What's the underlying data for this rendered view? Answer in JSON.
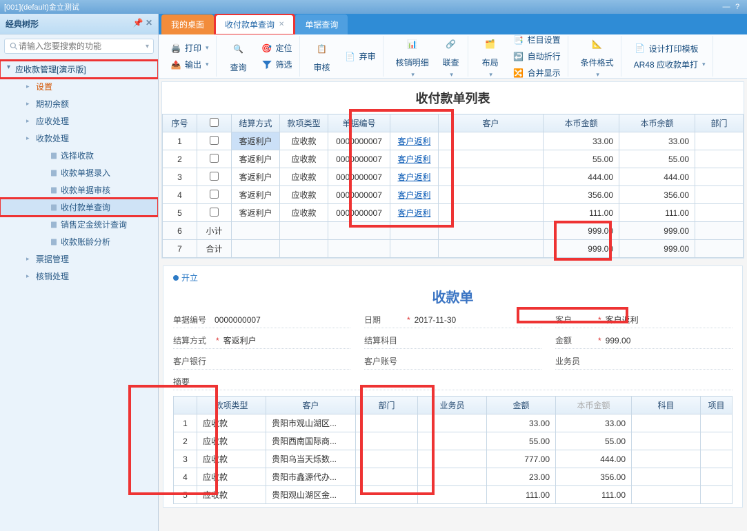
{
  "titlebar": {
    "text": "[001](default)金立测试"
  },
  "sidebar": {
    "title": "经典树形",
    "search_placeholder": "请输入您要搜索的功能",
    "root": "应收款管理[演示版]",
    "n_setup": "设置",
    "n_opening": "期初余额",
    "n_arproc": "应收处理",
    "n_rcvproc": "收款处理",
    "leaf_select": "选择收款",
    "leaf_entry": "收款单据录入",
    "leaf_audit": "收款单据审核",
    "leaf_query": "收付款单查询",
    "leaf_deposit": "销售定金统计查询",
    "leaf_aging": "收款账龄分析",
    "n_bill": "票据管理",
    "n_writeoff": "核销处理"
  },
  "tabs": {
    "desktop": "我的桌面",
    "query": "收付款单查询",
    "billquery": "单据查询"
  },
  "toolbar": {
    "print": "打印",
    "export": "输出",
    "query": "查询",
    "locate": "定位",
    "filter": "筛选",
    "audit": "审核",
    "abandon": "弃审",
    "detail": "核销明细",
    "link": "联查",
    "layout": "布局",
    "colset": "栏目设置",
    "autowrap": "自动折行",
    "mergeshow": "合并显示",
    "condfmt": "条件格式",
    "designtpl": "设计打印模板",
    "ar48": "AR48 应收款单打"
  },
  "list": {
    "title": "收付款单列表",
    "cols": {
      "seq": "序号",
      "check": "",
      "settle": "结算方式",
      "type": "款项类型",
      "billno": "单据编号",
      "blank": "",
      "cust": "客户",
      "bbamt": "本币金额",
      "bbbal": "本币余额",
      "dept": "部门"
    },
    "rows": [
      {
        "seq": "1",
        "settle": "客返利户",
        "type": "应收款",
        "billno": "0000000007",
        "cust": "客户返利",
        "bbamt": "33.00",
        "bbbal": "33.00"
      },
      {
        "seq": "2",
        "settle": "客返利户",
        "type": "应收款",
        "billno": "0000000007",
        "cust": "客户返利",
        "bbamt": "55.00",
        "bbbal": "55.00"
      },
      {
        "seq": "3",
        "settle": "客返利户",
        "type": "应收款",
        "billno": "0000000007",
        "cust": "客户返利",
        "bbamt": "444.00",
        "bbbal": "444.00"
      },
      {
        "seq": "4",
        "settle": "客返利户",
        "type": "应收款",
        "billno": "0000000007",
        "cust": "客户返利",
        "bbamt": "356.00",
        "bbbal": "356.00"
      },
      {
        "seq": "5",
        "settle": "客返利户",
        "type": "应收款",
        "billno": "0000000007",
        "cust": "客户返利",
        "bbamt": "111.00",
        "bbbal": "111.00"
      }
    ],
    "subtotal": {
      "seq": "6",
      "label": "小计",
      "bbamt": "999.00",
      "bbbal": "999.00"
    },
    "total": {
      "seq": "7",
      "label": "合计",
      "bbamt": "999.00",
      "bbbal": "999.00"
    }
  },
  "detail": {
    "status": "开立",
    "title": "收款单",
    "form": {
      "billno_l": "单据编号",
      "billno_v": "0000000007",
      "date_l": "日期",
      "date_v": "2017-11-30",
      "cust_l": "客户",
      "cust_v": "客户返利",
      "settle_l": "结算方式",
      "settle_v": "客返利户",
      "subj_l": "结算科目",
      "subj_v": "",
      "amt_l": "金额",
      "amt_v": "999.00",
      "bank_l": "客户银行",
      "bank_v": "",
      "acct_l": "客户账号",
      "acct_v": "",
      "sales_l": "业务员",
      "sales_v": "",
      "summary_l": "摘要",
      "summary_v": ""
    },
    "cols": {
      "seq": "",
      "type": "款项类型",
      "cust": "客户",
      "dept": "部门",
      "sales": "业务员",
      "amt": "金额",
      "bbamt": "本币金额",
      "subj": "科目",
      "proj": "项目"
    },
    "rows": [
      {
        "seq": "1",
        "type": "应收款",
        "cust": "贵阳市观山湖区...",
        "amt": "33.00",
        "bbamt": "33.00"
      },
      {
        "seq": "2",
        "type": "应收款",
        "cust": "贵阳西南国际商...",
        "amt": "55.00",
        "bbamt": "55.00"
      },
      {
        "seq": "3",
        "type": "应收款",
        "cust": "贵阳乌当天烁数...",
        "amt": "777.00",
        "bbamt": "444.00"
      },
      {
        "seq": "4",
        "type": "应收款",
        "cust": "贵阳市鑫源代办...",
        "amt": "23.00",
        "bbamt": "356.00"
      },
      {
        "seq": "5",
        "type": "应收款",
        "cust": "贵阳观山湖区金...",
        "amt": "111.00",
        "bbamt": "111.00"
      }
    ]
  }
}
